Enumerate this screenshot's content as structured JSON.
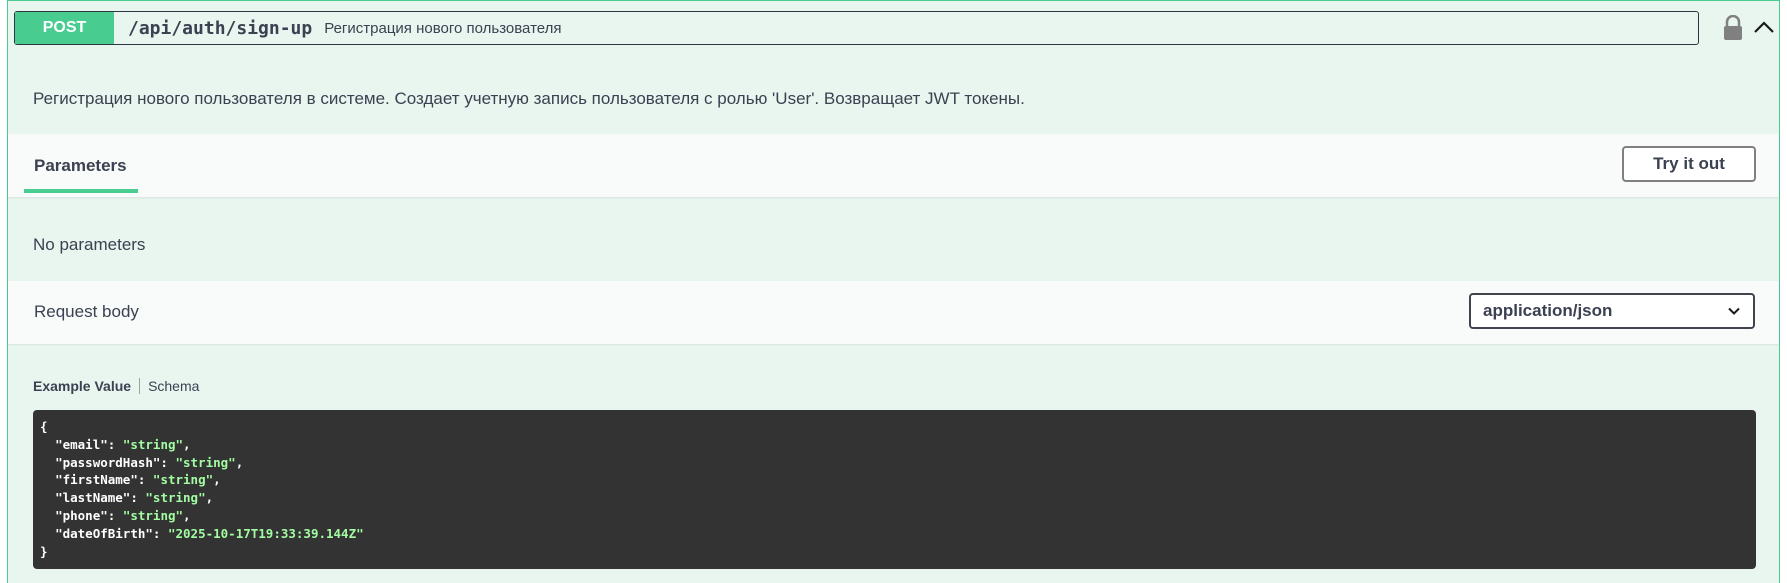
{
  "operation": {
    "method": "POST",
    "path": "/api/auth/sign-up",
    "summary": "Регистрация нового пользователя",
    "description": "Регистрация нового пользователя в системе. Создает учетную запись пользователя с ролью 'User'. Возвращает JWT токены."
  },
  "icons": {
    "lock": "lock-icon",
    "collapse": "chevron-up-icon",
    "select": "chevron-down-icon"
  },
  "parameters": {
    "tab_label": "Parameters",
    "try_button": "Try it out",
    "empty_text": "No parameters"
  },
  "request_body": {
    "label": "Request body",
    "content_type": "application/json"
  },
  "example": {
    "tab_active": "Example Value",
    "tab_other": "Schema",
    "open_brace": "{",
    "close_brace": "}",
    "fields": [
      {
        "key": "\"email\"",
        "value": "\"string\"",
        "comma": ","
      },
      {
        "key": "\"passwordHash\"",
        "value": "\"string\"",
        "comma": ","
      },
      {
        "key": "\"firstName\"",
        "value": "\"string\"",
        "comma": ","
      },
      {
        "key": "\"lastName\"",
        "value": "\"string\"",
        "comma": ","
      },
      {
        "key": "\"phone\"",
        "value": "\"string\"",
        "comma": ","
      },
      {
        "key": "\"dateOfBirth\"",
        "value": "\"2025-10-17T19:33:39.144Z\"",
        "comma": ""
      }
    ]
  },
  "colors": {
    "post": "#49cc90",
    "background": "#e8f6ef",
    "code_bg": "#333333",
    "code_string": "#a2fca2"
  }
}
